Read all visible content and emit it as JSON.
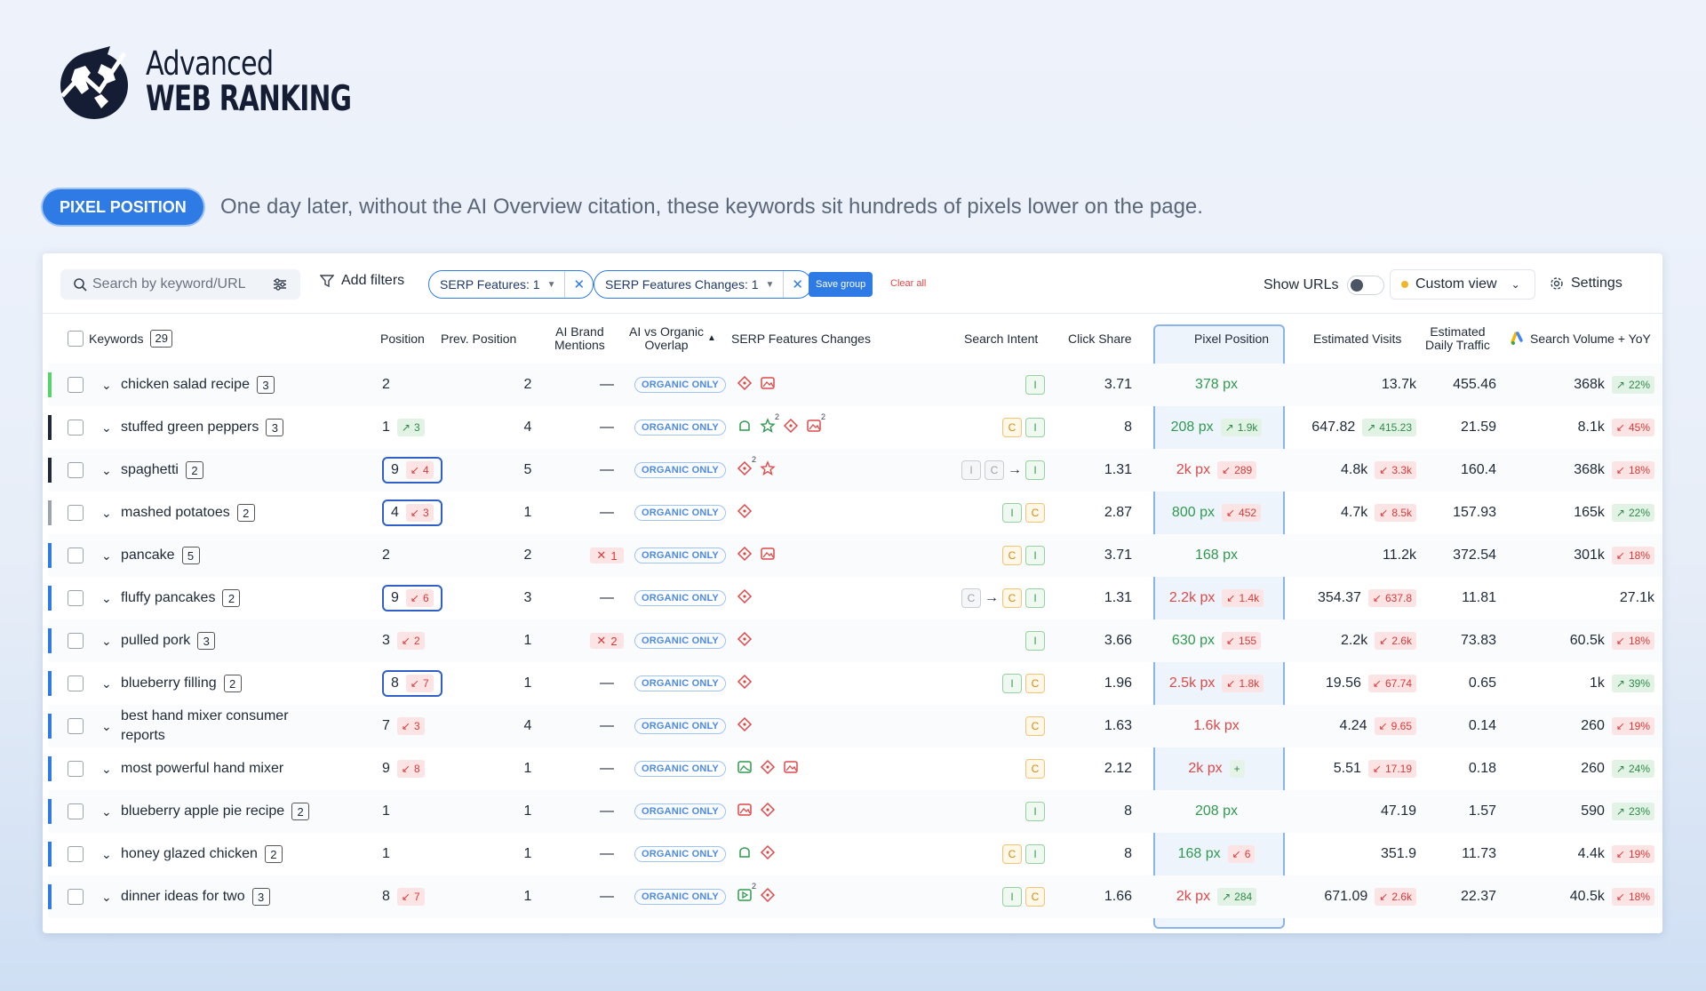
{
  "brand": {
    "line1": "Advanced",
    "line2": "WEB RANKING"
  },
  "badge": "PIXEL POSITION",
  "caption": "One day later, without the AI Overview citation, these keywords sit hundreds of pixels lower on the page.",
  "toolbar": {
    "search_placeholder": "Search by keyword/URL",
    "add_filters": "Add filters",
    "chip1": "SERP Features: 1",
    "chip2": "SERP Features Changes: 1",
    "save_group": "Save group",
    "clear_all": "Clear all",
    "show_urls": "Show URLs",
    "custom_view": "Custom view",
    "settings": "Settings"
  },
  "headers": {
    "keywords": "Keywords",
    "kw_count": "29",
    "position": "Position",
    "prev": "Prev. Position",
    "ai1": "AI Brand",
    "ai2": "Mentions",
    "ov1": "AI vs Organic",
    "ov2": "Overlap",
    "serp": "SERP Features Changes",
    "intent": "Search Intent",
    "click": "Click Share",
    "pixel": "Pixel Position",
    "visits": "Estimated Visits",
    "edt1": "Estimated",
    "edt2": "Daily Traffic",
    "vol": "Search Volume + YoY"
  },
  "organic_label": "ORGANIC ONLY",
  "colors": {
    "accent": "#2f7be6",
    "green": "#2f9a4f",
    "red": "#e04848"
  },
  "rows": [
    {
      "kw": "chicken salad recipe",
      "cnt": "3",
      "bar": "#55d46a",
      "pos": "2",
      "pdir": "",
      "pchg": "",
      "box": false,
      "prev": "2",
      "ai": "—",
      "aix": "",
      "serp": [
        "feat",
        "img"
      ],
      "intent": "I",
      "click": "3.71",
      "px": "378 px",
      "pxc": "green",
      "pxdir": "",
      "pxchg": "",
      "vis": "13.7k",
      "visdir": "",
      "vischg": "",
      "edt": "455.46",
      "vol": "368k",
      "voldir": "up",
      "volchg": "22%"
    },
    {
      "kw": "stuffed green peppers",
      "cnt": "3",
      "bar": "#1f2937",
      "pos": "1",
      "pdir": "up",
      "pchg": "3",
      "box": false,
      "prev": "4",
      "ai": "—",
      "aix": "",
      "serp": [
        "recipe",
        "star2",
        "feat",
        "img2"
      ],
      "intent": "CI",
      "click": "8",
      "px": "208 px",
      "pxc": "green",
      "pxdir": "up",
      "pxchg": "1.9k",
      "vis": "647.82",
      "visdir": "up",
      "vischg": "415.23",
      "edt": "21.59",
      "vol": "8.1k",
      "voldir": "dn",
      "volchg": "45%"
    },
    {
      "kw": "spaghetti",
      "cnt": "2",
      "bar": "#1f2937",
      "pos": "9",
      "pdir": "dn",
      "pchg": "4",
      "box": true,
      "prev": "5",
      "ai": "—",
      "aix": "",
      "serp": [
        "feat2",
        "star"
      ],
      "intent": "GGI",
      "click": "1.31",
      "px": "2k px",
      "pxc": "red",
      "pxdir": "dn",
      "pxchg": "289",
      "vis": "4.8k",
      "visdir": "dn",
      "vischg": "3.3k",
      "edt": "160.4",
      "vol": "368k",
      "voldir": "dn",
      "volchg": "18%"
    },
    {
      "kw": "mashed potatoes",
      "cnt": "2",
      "bar": "#9aa3ae",
      "pos": "4",
      "pdir": "dn",
      "pchg": "3",
      "box": true,
      "prev": "1",
      "ai": "—",
      "aix": "",
      "serp": [
        "feat"
      ],
      "intent": "IC",
      "click": "2.87",
      "px": "800 px",
      "pxc": "green",
      "pxdir": "dn",
      "pxchg": "452",
      "vis": "4.7k",
      "visdir": "dn",
      "vischg": "8.5k",
      "edt": "157.93",
      "vol": "165k",
      "voldir": "up",
      "volchg": "22%"
    },
    {
      "kw": "pancake",
      "cnt": "5",
      "bar": "#2f7be6",
      "pos": "2",
      "pdir": "",
      "pchg": "",
      "box": false,
      "prev": "2",
      "ai": "",
      "aix": "1",
      "serp": [
        "feat",
        "img"
      ],
      "intent": "CI",
      "click": "3.71",
      "px": "168 px",
      "pxc": "green",
      "pxdir": "",
      "pxchg": "",
      "vis": "11.2k",
      "visdir": "",
      "vischg": "",
      "edt": "372.54",
      "vol": "301k",
      "voldir": "dn",
      "volchg": "18%"
    },
    {
      "kw": "fluffy pancakes",
      "cnt": "2",
      "bar": "#2f7be6",
      "pos": "9",
      "pdir": "dn",
      "pchg": "6",
      "box": true,
      "prev": "3",
      "ai": "—",
      "aix": "",
      "serp": [
        "feat"
      ],
      "intent": "GCI",
      "click": "1.31",
      "px": "2.2k px",
      "pxc": "red",
      "pxdir": "dn",
      "pxchg": "1.4k",
      "vis": "354.37",
      "visdir": "dn",
      "vischg": "637.8",
      "edt": "11.81",
      "vol": "27.1k",
      "voldir": "",
      "volchg": ""
    },
    {
      "kw": "pulled pork",
      "cnt": "3",
      "bar": "#2f7be6",
      "pos": "3",
      "pdir": "dn",
      "pchg": "2",
      "box": false,
      "prev": "1",
      "ai": "",
      "aix": "2",
      "serp": [
        "feat"
      ],
      "intent": "I",
      "click": "3.66",
      "px": "630 px",
      "pxc": "green",
      "pxdir": "dn",
      "pxchg": "155",
      "vis": "2.2k",
      "visdir": "dn",
      "vischg": "2.6k",
      "edt": "73.83",
      "vol": "60.5k",
      "voldir": "dn",
      "volchg": "18%"
    },
    {
      "kw": "blueberry filling",
      "cnt": "2",
      "bar": "#2f7be6",
      "pos": "8",
      "pdir": "dn",
      "pchg": "7",
      "box": true,
      "prev": "1",
      "ai": "—",
      "aix": "",
      "serp": [
        "feat"
      ],
      "intent": "IC",
      "click": "1.96",
      "px": "2.5k px",
      "pxc": "red",
      "pxdir": "dn",
      "pxchg": "1.8k",
      "vis": "19.56",
      "visdir": "dn",
      "vischg": "67.74",
      "edt": "0.65",
      "vol": "1k",
      "voldir": "up",
      "volchg": "39%"
    },
    {
      "kw": "best hand mixer consumer reports",
      "cnt": "",
      "bar": "#2f7be6",
      "pos": "7",
      "pdir": "dn",
      "pchg": "3",
      "box": false,
      "prev": "4",
      "ai": "—",
      "aix": "",
      "serp": [
        "feat"
      ],
      "intent": "C",
      "click": "1.63",
      "px": "1.6k px",
      "pxc": "red",
      "pxdir": "",
      "pxchg": "",
      "vis": "4.24",
      "visdir": "dn",
      "vischg": "9.65",
      "edt": "0.14",
      "vol": "260",
      "voldir": "dn",
      "volchg": "19%"
    },
    {
      "kw": "most powerful hand mixer",
      "cnt": "",
      "bar": "#2f7be6",
      "pos": "9",
      "pdir": "dn",
      "pchg": "8",
      "box": false,
      "prev": "1",
      "ai": "—",
      "aix": "",
      "serp": [
        "imgg",
        "feat",
        "img"
      ],
      "intent": "C",
      "click": "2.12",
      "px": "2k px",
      "pxc": "red",
      "pxdir": "plus",
      "pxchg": "+",
      "vis": "5.51",
      "visdir": "dn",
      "vischg": "17.19",
      "edt": "0.18",
      "vol": "260",
      "voldir": "up",
      "volchg": "24%"
    },
    {
      "kw": "blueberry apple pie recipe",
      "cnt": "2",
      "bar": "#2f7be6",
      "pos": "1",
      "pdir": "",
      "pchg": "",
      "box": false,
      "prev": "1",
      "ai": "—",
      "aix": "",
      "serp": [
        "img",
        "feat"
      ],
      "intent": "I",
      "click": "8",
      "px": "208 px",
      "pxc": "green",
      "pxdir": "",
      "pxchg": "",
      "vis": "47.19",
      "visdir": "",
      "vischg": "",
      "edt": "1.57",
      "vol": "590",
      "voldir": "up",
      "volchg": "23%"
    },
    {
      "kw": "honey glazed chicken",
      "cnt": "2",
      "bar": "#2f7be6",
      "pos": "1",
      "pdir": "",
      "pchg": "",
      "box": false,
      "prev": "1",
      "ai": "—",
      "aix": "",
      "serp": [
        "recipe",
        "feat"
      ],
      "intent": "CI",
      "click": "8",
      "px": "168 px",
      "pxc": "green",
      "pxdir": "dn",
      "pxchg": "6",
      "vis": "351.9",
      "visdir": "",
      "vischg": "",
      "edt": "11.73",
      "vol": "4.4k",
      "voldir": "dn",
      "volchg": "19%"
    },
    {
      "kw": "dinner ideas for two",
      "cnt": "3",
      "bar": "#2f7be6",
      "pos": "8",
      "pdir": "dn",
      "pchg": "7",
      "box": false,
      "prev": "1",
      "ai": "—",
      "aix": "",
      "serp": [
        "video2",
        "feat"
      ],
      "intent": "IC",
      "click": "1.66",
      "px": "2k px",
      "pxc": "red",
      "pxdir": "up",
      "pxchg": "284",
      "vis": "671.09",
      "visdir": "dn",
      "vischg": "2.6k",
      "edt": "22.37",
      "vol": "40.5k",
      "voldir": "dn",
      "volchg": "18%"
    }
  ]
}
